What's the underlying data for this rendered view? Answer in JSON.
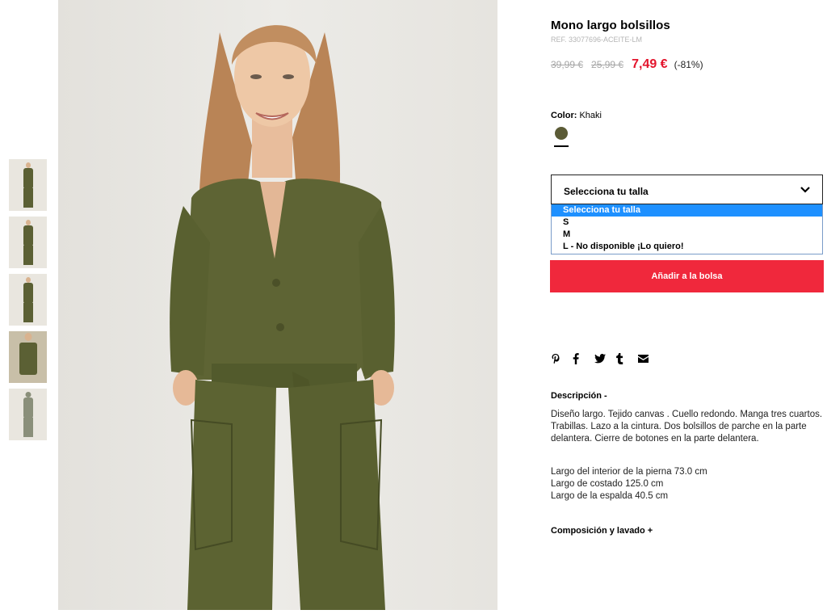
{
  "product": {
    "title": "Mono largo bolsillos",
    "ref": "REF. 33077696-ACEITE-LM",
    "price_original": "39,99 €",
    "price_previous": "25,99 €",
    "price_current": "7,49 €",
    "discount": "(-81%)"
  },
  "color": {
    "label": "Color:",
    "value": "Khaki",
    "swatch_hex": "#5b5b36"
  },
  "size": {
    "selected": "Selecciona tu talla",
    "options": [
      "Selecciona tu talla",
      "S",
      "M",
      "L - No disponible ¡Lo quiero!"
    ]
  },
  "actions": {
    "add_to_bag": "Añadir a la bolsa"
  },
  "share_icons": [
    "pinterest-icon",
    "facebook-icon",
    "twitter-icon",
    "tumblr-icon",
    "email-icon"
  ],
  "description": {
    "heading": "Descripción  -",
    "text": "Diseño largo. Tejido canvas . Cuello redondo. Manga tres cuartos. Trabillas. Lazo a la cintura. Dos bolsillos de parche en la parte delantera. Cierre de botones en la parte delantera.",
    "measurements": [
      "Largo del interior de la pierna 73.0 cm",
      "Largo de costado 125.0 cm",
      "Largo de la espalda 40.5 cm"
    ]
  },
  "composition": {
    "heading": "Composición y lavado  +"
  },
  "colors": {
    "accent_red": "#e3152d",
    "button_red": "#f0283c",
    "select_highlight": "#1e90ff"
  }
}
